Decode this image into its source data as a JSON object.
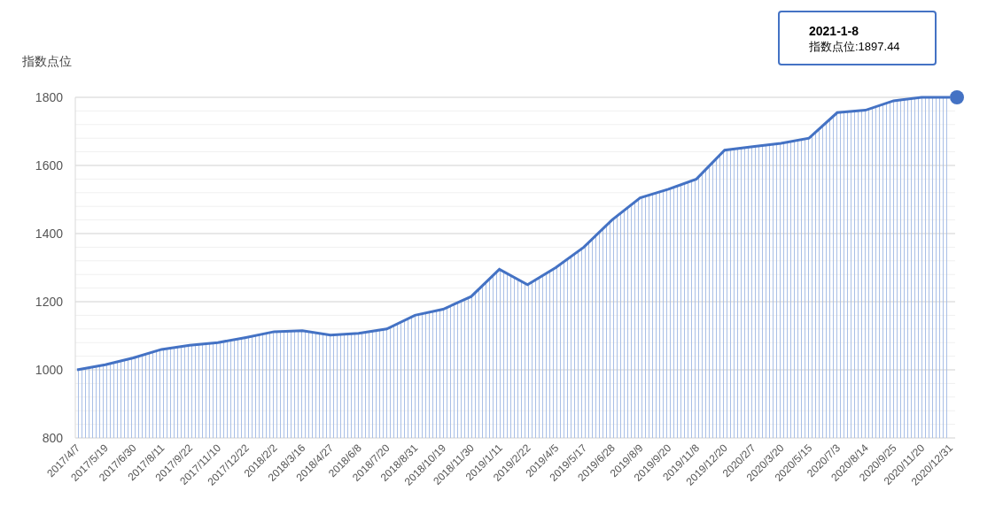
{
  "chart": {
    "chart_data": {
      "type": "area",
      "ylabel": "指数点位",
      "categories": [
        "2017/4/7",
        "2017/5/19",
        "2017/6/30",
        "2017/8/11",
        "2017/9/22",
        "2017/11/10",
        "2017/12/22",
        "2018/2/2",
        "2018/3/16",
        "2018/4/27",
        "2018/6/8",
        "2018/7/20",
        "2018/8/31",
        "2018/10/19",
        "2018/11/30",
        "2019/1/11",
        "2019/2/22",
        "2019/4/5",
        "2019/5/17",
        "2019/6/28",
        "2019/8/9",
        "2019/9/20",
        "2019/11/8",
        "2019/12/20",
        "2020/2/7",
        "2020/3/20",
        "2020/5/15",
        "2020/7/3",
        "2020/8/14",
        "2020/9/25",
        "2020/11/20",
        "2020/12/31"
      ],
      "series": [
        {
          "color": "#4472c4",
          "values": [
            1000,
            1015,
            1035,
            1060,
            1072,
            1080,
            1095,
            1112,
            1115,
            1102,
            1107,
            1120,
            1160,
            1178,
            1215,
            1295,
            1250,
            1300,
            1360,
            1440,
            1505,
            1530,
            1560,
            1645,
            1655,
            1665,
            1680,
            1755,
            1762,
            1790,
            1800,
            1800
          ]
        }
      ],
      "grid": true,
      "ylim": [
        800,
        1800
      ],
      "yticks": [
        800,
        1000,
        1200,
        1400,
        1600,
        1800
      ]
    },
    "tooltip": {
      "title": "2021-1-8",
      "text": "指数点位:1897.44"
    }
  }
}
